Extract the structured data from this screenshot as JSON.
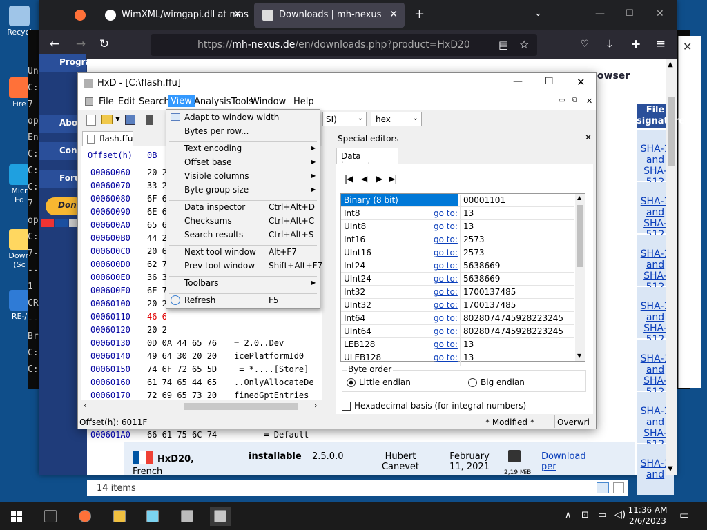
{
  "desktop": {
    "icons": [
      {
        "label": "Recycl",
        "color": "#9fc5e8"
      },
      {
        "label": "Fire",
        "color": "#ff7139"
      },
      {
        "label": "Micr Ed",
        "color": "#1fa0e0"
      },
      {
        "label": "Down (Sc",
        "color": "#ffd760"
      },
      {
        "label": "RE-/",
        "color": "#2f7bd6"
      }
    ]
  },
  "cmd": {
    "lines": [
      "Un",
      "C:",
      "7",
      "op",
      "En",
      "C:",
      "C:",
      "C:",
      "7",
      "op",
      "C:",
      "7-",
      "--",
      "1",
      "CR",
      "--",
      "Br",
      "C:",
      "C:"
    ]
  },
  "firefox": {
    "tabs": [
      {
        "title": "",
        "icon": "firefox-icon"
      },
      {
        "title": "WimXML/wimgapi.dll at maste",
        "icon": "github-icon"
      },
      {
        "title": "Downloads | mh-nexus",
        "icon": "mh-nexus-icon"
      }
    ],
    "url_prefix": "https://",
    "url_domain": "mh-nexus.de",
    "url_path": "/en/downloads.php?product=HxD20",
    "page": {
      "nav_items": [
        "Programs",
        "Abou",
        "Conta",
        "Foru"
      ],
      "donate": "Don",
      "browser_text": "rowser",
      "col_header": "File signatures",
      "sha_links": [
        "SHA-1 and SHA-512",
        "SHA-1 and SHA-512",
        "SHA-1 and SHA-512",
        "SHA-1 and SHA-512",
        "SHA-1 and SHA-512",
        "SHA-1 and SHA-512",
        "SHA-1 and"
      ],
      "row": {
        "name": "HxD20,",
        "lang": "French",
        "type": "installable",
        "version": "2.5.0.0",
        "author": "Hubert Canevet",
        "date": "February 11, 2021",
        "size": "2,19 MiB",
        "download": "Download per"
      }
    },
    "status": "14 items"
  },
  "hxd": {
    "title": "HxD - [C:\\flash.ffu]",
    "menu": [
      "File",
      "Edit",
      "Search",
      "View",
      "Analysis",
      "Tools",
      "Window",
      "Help"
    ],
    "active_menu": "View",
    "encoding_select": "SI)",
    "base_select": "hex",
    "file_tab": "flash.ffu",
    "offset_header": "Offset(h)",
    "offset_header_hex": "0B",
    "hex_rows": [
      {
        "off": "00060060",
        "hex": "20 2",
        "txt": "",
        "red": false
      },
      {
        "off": "00060070",
        "hex": "33 2",
        "txt": "",
        "red": false
      },
      {
        "off": "00060080",
        "hex": "6F 6",
        "txt": "",
        "red": false
      },
      {
        "off": "00060090",
        "hex": "6E 6",
        "txt": "",
        "red": false
      },
      {
        "off": "000600A0",
        "hex": "65 6",
        "txt": "",
        "red": false
      },
      {
        "off": "000600B0",
        "hex": "44 2",
        "txt": "",
        "red": false
      },
      {
        "off": "000600C0",
        "hex": "20 6",
        "txt": "",
        "red": false
      },
      {
        "off": "000600D0",
        "hex": "62 7",
        "txt": "",
        "red": false
      },
      {
        "off": "000600E0",
        "hex": "36 3",
        "txt": "",
        "red": false
      },
      {
        "off": "000600F0",
        "hex": "6E 7",
        "txt": "",
        "red": false
      },
      {
        "off": "00060100",
        "hex": "20 2",
        "txt": "",
        "red": false
      },
      {
        "off": "00060110",
        "hex": "46 6",
        "txt": "",
        "red": true
      },
      {
        "off": "00060120",
        "hex": "20 2",
        "txt": "",
        "red": false
      },
      {
        "off": "00060130",
        "hex": "0D 0A 44 65 76",
        "txt": "= 2.0..Dev",
        "red": false
      },
      {
        "off": "00060140",
        "hex": "49 64 30 20 20",
        "txt": "icePlatformId0",
        "red": false
      },
      {
        "off": "00060150",
        "hex": "74 6F 72 65 5D",
        "txt": " = *....[Store]",
        "red": false
      },
      {
        "off": "00060160",
        "hex": "61 74 65 44 65",
        "txt": "..OnlyAllocateDe",
        "red": false
      },
      {
        "off": "00060170",
        "hex": "72 69 65 73 20",
        "txt": "finedGptEntries",
        "red": false
      },
      {
        "off": "00060180",
        "hex": "6F 72 65 54 79",
        "txt": "= False..StoreTy",
        "red": false
      },
      {
        "off": "00060190",
        "hex": "20 20 20 20 20",
        "txt": "pe",
        "red": false
      },
      {
        "off": "000601A0",
        "hex": "66 61 75 6C 74",
        "txt": "      = Default",
        "red": false
      }
    ],
    "status_offset": "Offset(h): 6011F",
    "status_modified": "* Modified *",
    "status_mode": "Overwri",
    "special_editors": "Special editors",
    "data_inspector_tab": "Data inspector",
    "inspector_rows": [
      {
        "name": "Binary (8 bit)",
        "goto": "",
        "value": "00001101"
      },
      {
        "name": "Int8",
        "goto": "go to:",
        "value": "13"
      },
      {
        "name": "UInt8",
        "goto": "go to:",
        "value": "13"
      },
      {
        "name": "Int16",
        "goto": "go to:",
        "value": "2573"
      },
      {
        "name": "UInt16",
        "goto": "go to:",
        "value": "2573"
      },
      {
        "name": "Int24",
        "goto": "go to:",
        "value": "5638669"
      },
      {
        "name": "UInt24",
        "goto": "go to:",
        "value": "5638669"
      },
      {
        "name": "Int32",
        "goto": "go to:",
        "value": "1700137485"
      },
      {
        "name": "UInt32",
        "goto": "go to:",
        "value": "1700137485"
      },
      {
        "name": "Int64",
        "goto": "go to:",
        "value": "8028074745928223245"
      },
      {
        "name": "UInt64",
        "goto": "go to:",
        "value": "8028074745928223245"
      },
      {
        "name": "LEB128",
        "goto": "go to:",
        "value": "13"
      },
      {
        "name": "ULEB128",
        "goto": "go to:",
        "value": "13"
      }
    ],
    "byte_order_label": "Byte order",
    "little_endian": "Little endian",
    "big_endian": "Big endian",
    "hex_basis": "Hexadecimal basis (for integral numbers)"
  },
  "view_menu": {
    "items": [
      {
        "label": "Adapt to window width",
        "shortcut": "",
        "submenu": false,
        "sep_after": false
      },
      {
        "label": "Bytes per row...",
        "shortcut": "",
        "submenu": false,
        "sep_after": true
      },
      {
        "label": "Text encoding",
        "shortcut": "",
        "submenu": true,
        "sep_after": false
      },
      {
        "label": "Offset base",
        "shortcut": "",
        "submenu": true,
        "sep_after": false
      },
      {
        "label": "Visible columns",
        "shortcut": "",
        "submenu": true,
        "sep_after": false
      },
      {
        "label": "Byte group size",
        "shortcut": "",
        "submenu": true,
        "sep_after": true
      },
      {
        "label": "Data inspector",
        "shortcut": "Ctrl+Alt+D",
        "submenu": false,
        "sep_after": false
      },
      {
        "label": "Checksums",
        "shortcut": "Ctrl+Alt+C",
        "submenu": false,
        "sep_after": false
      },
      {
        "label": "Search results",
        "shortcut": "Ctrl+Alt+S",
        "submenu": false,
        "sep_after": true
      },
      {
        "label": "Next tool window",
        "shortcut": "Alt+F7",
        "submenu": false,
        "sep_after": false
      },
      {
        "label": "Prev tool window",
        "shortcut": "Shift+Alt+F7",
        "submenu": false,
        "sep_after": true
      },
      {
        "label": "Toolbars",
        "shortcut": "",
        "submenu": true,
        "sep_after": true
      },
      {
        "label": "Refresh",
        "shortcut": "F5",
        "submenu": false,
        "sep_after": false
      }
    ]
  },
  "taskbar": {
    "apps": [
      "cmd-icon",
      "firefox-icon",
      "file-explorer-icon",
      "notepad-icon",
      "7zip-icon",
      "hxd-icon"
    ],
    "time": "11:36 AM",
    "date": "2/6/2023"
  },
  "colors": {
    "accent": "#0078d7",
    "menu_active": "#3399ff",
    "link": "#0b3fbb",
    "title_bar": "#202124"
  }
}
